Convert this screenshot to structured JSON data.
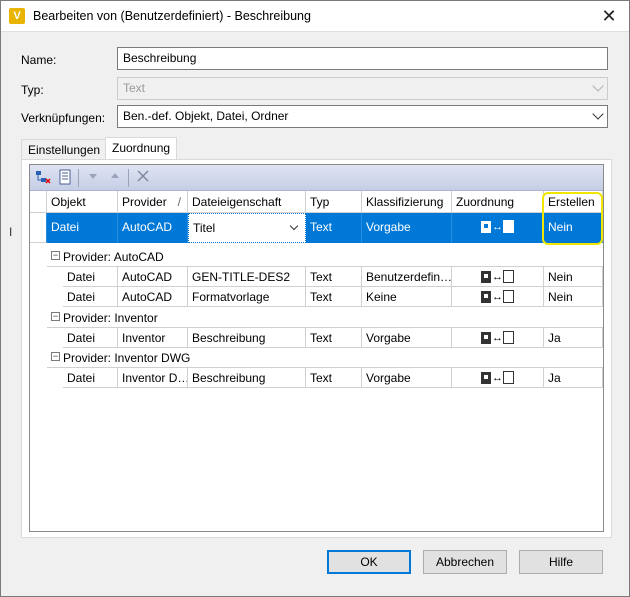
{
  "window": {
    "title": "Bearbeiten von (Benutzerdefiniert) - Beschreibung",
    "app_icon_letter": "V",
    "close_glyph": "✕"
  },
  "form": {
    "name_label": "Name:",
    "name_value": "Beschreibung",
    "type_label": "Typ:",
    "type_value": "Text",
    "links_label": "Verknüpfungen:",
    "links_value": "Ben.-def. Objekt, Datei, Ordner"
  },
  "tabs": [
    {
      "label": "Einstellungen",
      "active": false
    },
    {
      "label": "Zuordnung",
      "active": true
    }
  ],
  "grid": {
    "columns": [
      "Objekt",
      "Provider",
      "Dateieigenschaft",
      "Typ",
      "Klassifizierung",
      "Zuordnung",
      "Erstellen"
    ],
    "sort_indicator": "/",
    "selected_row": {
      "objekt": "Datei",
      "provider": "AutoCAD",
      "eigenschaft": "Titel",
      "typ": "Text",
      "klass": "Vorgabe",
      "erstellen": "Nein"
    },
    "groups": [
      {
        "label": "Provider: AutoCAD",
        "rows": [
          {
            "objekt": "Datei",
            "provider": "AutoCAD",
            "eigenschaft": "GEN-TITLE-DES2",
            "typ": "Text",
            "klass": "Benutzerdefin…",
            "erstellen": "Nein"
          },
          {
            "objekt": "Datei",
            "provider": "AutoCAD",
            "eigenschaft": "Formatvorlage",
            "typ": "Text",
            "klass": "Keine",
            "erstellen": "Nein"
          }
        ]
      },
      {
        "label": "Provider: Inventor",
        "rows": [
          {
            "objekt": "Datei",
            "provider": "Inventor",
            "eigenschaft": "Beschreibung",
            "typ": "Text",
            "klass": "Vorgabe",
            "erstellen": "Ja"
          }
        ]
      },
      {
        "label": "Provider: Inventor DWG",
        "rows": [
          {
            "objekt": "Datei",
            "provider": "Inventor D…",
            "eigenschaft": "Beschreibung",
            "typ": "Text",
            "klass": "Vorgabe",
            "erstellen": "Ja"
          }
        ]
      }
    ],
    "group_toggle": "−",
    "mapping_arrows": "↔"
  },
  "buttons": {
    "ok": "OK",
    "cancel": "Abbrechen",
    "help": "Hilfe"
  },
  "colors": {
    "selection": "#0078d7",
    "highlight": "#f2e600",
    "app_icon": "#e8b400"
  }
}
